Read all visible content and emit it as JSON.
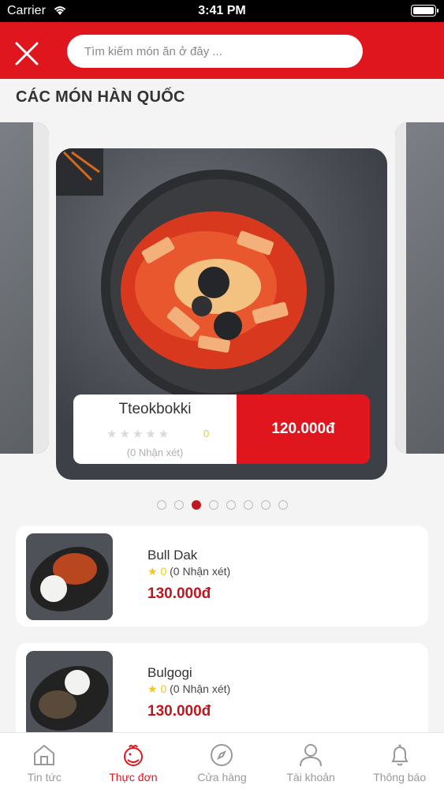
{
  "status_bar": {
    "carrier": "Carrier",
    "time": "3:41 PM"
  },
  "header": {
    "search_placeholder": "Tìm kiếm món ăn ở đây ..."
  },
  "section_title": "CÁC MÓN HÀN QUỐC",
  "carousel": {
    "featured": {
      "name": "Tteokbokki",
      "rating": "0",
      "stars_filled": 0,
      "stars_total": 5,
      "reviews": "(0 Nhận xét)",
      "price": "120.000đ"
    },
    "page_count": 8,
    "active_page": 3
  },
  "menu_items": [
    {
      "name": "Bull Dak",
      "rating": "0",
      "reviews": "(0 Nhận xét)",
      "price": "130.000đ"
    },
    {
      "name": "Bulgogi",
      "rating": "0",
      "reviews": "(0 Nhận xét)",
      "price": "130.000đ"
    }
  ],
  "tabbar": {
    "tabs": [
      {
        "label": "Tin tức",
        "icon": "home-icon",
        "active": false
      },
      {
        "label": "Thực đơn",
        "icon": "chicken-icon",
        "active": true
      },
      {
        "label": "Cửa hàng",
        "icon": "compass-icon",
        "active": false
      },
      {
        "label": "Tài khoản",
        "icon": "user-icon",
        "active": false
      },
      {
        "label": "Thông báo",
        "icon": "bell-icon",
        "active": false
      }
    ]
  },
  "colors": {
    "brand_red": "#e0161e",
    "price_red": "#c0161e",
    "star_yellow": "#f5c518"
  }
}
